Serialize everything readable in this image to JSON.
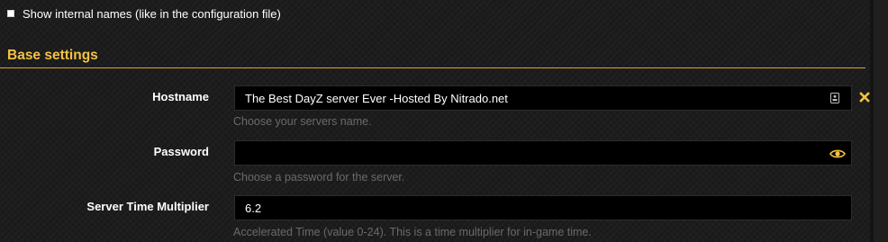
{
  "show_internal_names": {
    "label": "Show internal names (like in the configuration file)",
    "checked": false
  },
  "section": {
    "title": "Base settings"
  },
  "fields": {
    "hostname": {
      "label": "Hostname",
      "value": "The Best DayZ server Ever -Hosted By Nitrado.net",
      "help": "Choose your servers name."
    },
    "password": {
      "label": "Password",
      "value": "",
      "help": "Choose a password for the server."
    },
    "server_time_multiplier": {
      "label": "Server Time Multiplier",
      "value": "6.2",
      "help": "Accelerated Time (value 0-24). This is a time multiplier for in-game time."
    }
  },
  "icons": {
    "hostname_field_icon": "contact-card-icon",
    "password_toggle": "eye-icon",
    "hostname_clear": "close-x-icon"
  },
  "colors": {
    "accent": "#f5c242",
    "section_rule": "#d9a62a",
    "background": "#1c1c1c",
    "input_background": "#000000",
    "help_text": "#6a6a6a"
  }
}
